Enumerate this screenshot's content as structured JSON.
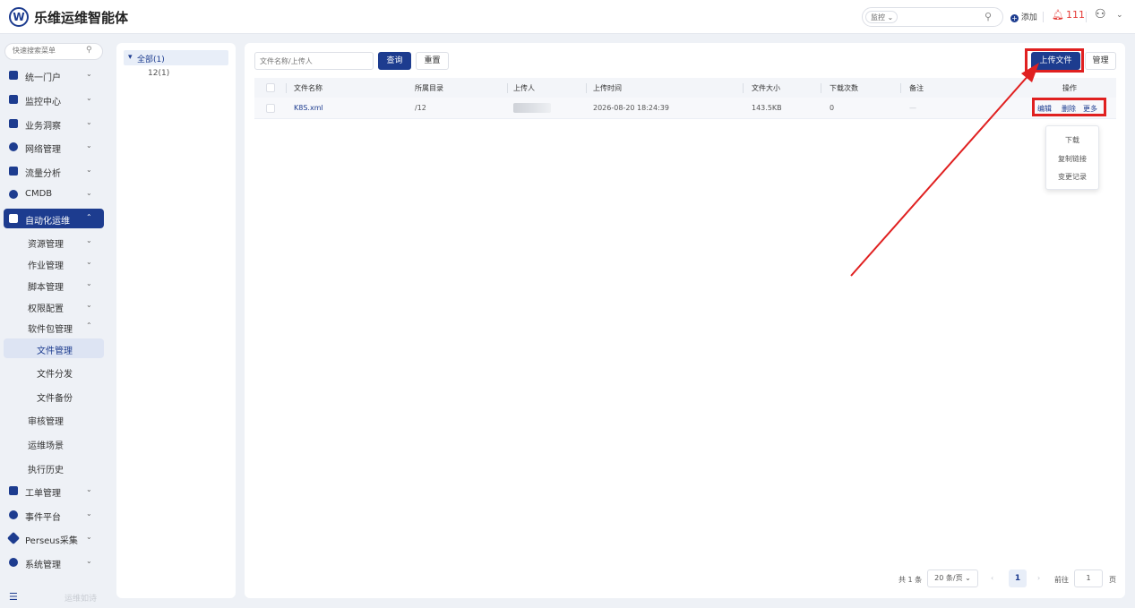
{
  "header": {
    "logo_glyph": "W",
    "title": "乐维运维智能体",
    "search_scope": "监控",
    "add_label": "添加",
    "alert_count": "111"
  },
  "sidebar": {
    "search_placeholder": "快速搜索菜单",
    "items": [
      {
        "label": "统一门户",
        "icon": "home-icon"
      },
      {
        "label": "监控中心",
        "icon": "monitor-icon"
      },
      {
        "label": "业务洞察",
        "icon": "insight-icon"
      },
      {
        "label": "网络管理",
        "icon": "globe-icon"
      },
      {
        "label": "流量分析",
        "icon": "chart-icon"
      },
      {
        "label": "CMDB",
        "icon": "database-icon"
      },
      {
        "label": "自动化运维",
        "icon": "automation-icon"
      },
      {
        "label": "工单管理",
        "icon": "ticket-icon"
      },
      {
        "label": "事件平台",
        "icon": "bell-icon"
      },
      {
        "label": "Perseus采集",
        "icon": "diamond-icon"
      },
      {
        "label": "系统管理",
        "icon": "gear-icon"
      }
    ],
    "sub_items": [
      "资源管理",
      "作业管理",
      "脚本管理",
      "权限配置",
      "软件包管理"
    ],
    "pkg_children": [
      "文件管理",
      "文件分发",
      "文件备份"
    ],
    "tail_items": [
      "审核管理",
      "运维场景",
      "执行历史"
    ],
    "footer_text": "运维如诗"
  },
  "tree": {
    "root": "全部(1)",
    "child": "12(1)"
  },
  "toolbar": {
    "filter_placeholder": "文件名称/上传人",
    "query_label": "查询",
    "reset_label": "重置",
    "upload_label": "上传文件",
    "manage_label": "管理"
  },
  "table": {
    "columns": [
      "文件名称",
      "所属目录",
      "上传人",
      "上传时间",
      "文件大小",
      "下载次数",
      "备注",
      "操作"
    ],
    "rows": [
      {
        "name": "K8S.xml",
        "directory": "/12",
        "uploader": "",
        "upload_time": "2026-08-20 18:24:39",
        "size": "143.5KB",
        "downloads": "0",
        "remark": "—"
      }
    ],
    "actions": {
      "edit": "编辑",
      "delete": "删除",
      "more": "更多"
    }
  },
  "more_menu": [
    "下载",
    "复制链接",
    "变更记录"
  ],
  "pagination": {
    "total": "共 1 条",
    "page_size": "20 条/页",
    "current_page": "1",
    "goto_label": "前往",
    "goto_value": "1",
    "page_suffix": "页"
  },
  "colors": {
    "primary": "#1d3c8f",
    "highlight": "#e02020",
    "background": "#eef1f6"
  }
}
